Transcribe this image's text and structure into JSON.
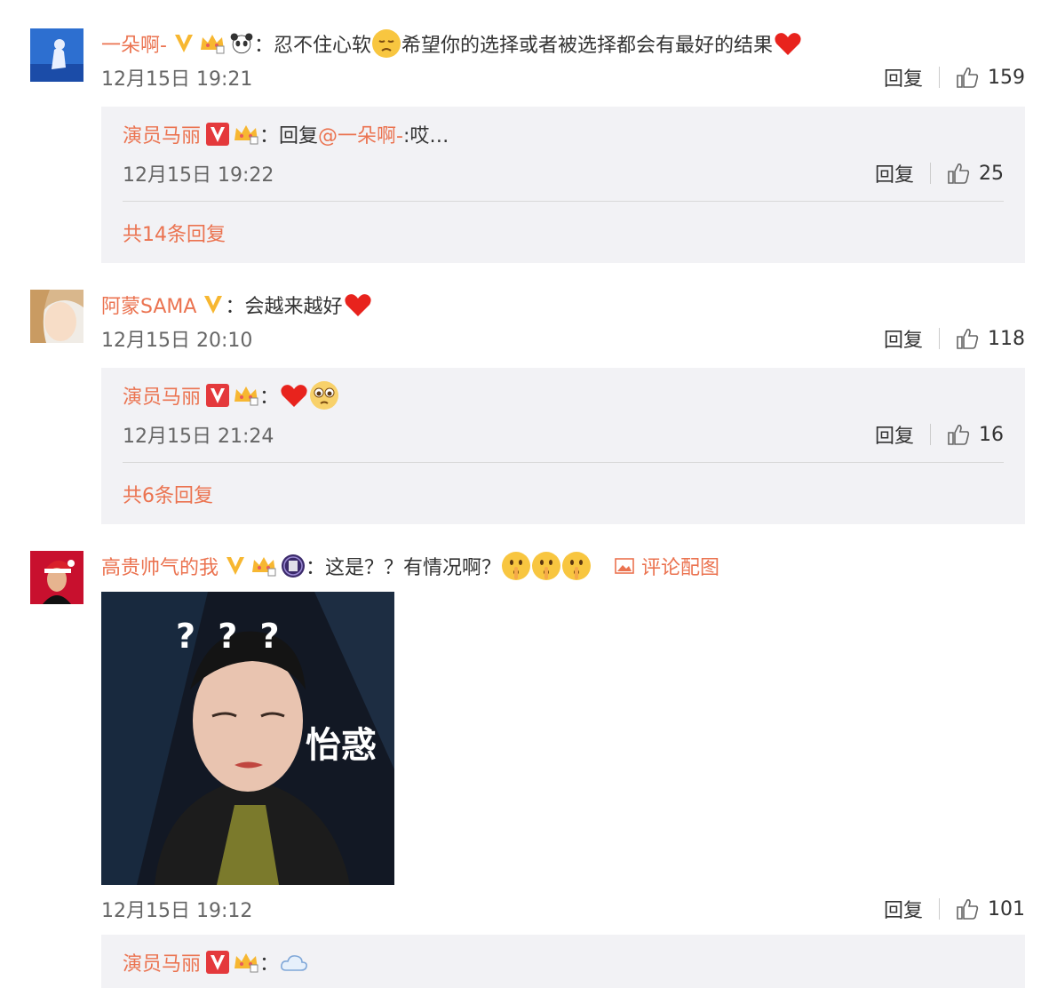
{
  "comments": [
    {
      "user": "一朵啊-",
      "text_a": "忍不住心软",
      "text_b": "希望你的选择或者被选择都会有最好的结果",
      "time": "12月15日 19:21",
      "reply_label": "回复",
      "likes": "159",
      "reply": {
        "user": "演员马丽",
        "prefix": "回复",
        "mention": "@一朵啊-",
        "text": ":哎…",
        "time": "12月15日 19:22",
        "reply_label": "回复",
        "likes": "25"
      },
      "more": "共14条回复"
    },
    {
      "user": "阿蒙SAMA",
      "text": "会越来越好",
      "time": "12月15日 20:10",
      "reply_label": "回复",
      "likes": "118",
      "reply": {
        "user": "演员马丽",
        "time": "12月15日 21:24",
        "reply_label": "回复",
        "likes": "16"
      },
      "more": "共6条回复"
    },
    {
      "user": "高贵帅气的我",
      "text": "这是？？有情况啊？",
      "pic_label": "评论配图",
      "meme_marks": "? ? ?",
      "meme_caption": "怡惑",
      "time": "12月15日 19:12",
      "reply_label": "回复",
      "likes": "101",
      "reply": {
        "user": "演员马丽"
      }
    }
  ],
  "colon": "："
}
